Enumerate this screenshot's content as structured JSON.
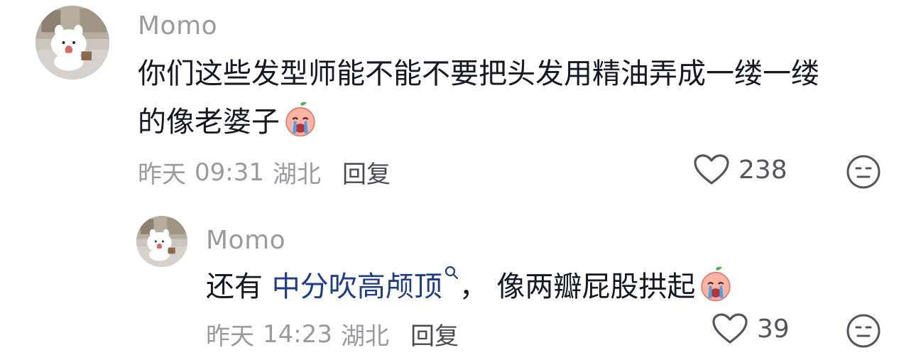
{
  "comments": [
    {
      "user": "Momo",
      "text_line1": "你们这些发型师能不能不要把头发用精油弄成一缕一缕",
      "text_line2": "的像老婆子",
      "emoji": "crying-face-icon",
      "date": "昨天",
      "time": "09:31",
      "location": "湖北",
      "reply_label": "回复",
      "likes": "238"
    }
  ],
  "reply": {
    "user": "Momo",
    "text_prefix": "还有 ",
    "link_text": "中分吹高颅顶",
    "text_suffix": "， 像两瓣屁股拱起",
    "emoji": "crying-face-icon",
    "date": "昨天",
    "time": "14:23",
    "location": "湖北",
    "reply_label": "回复",
    "likes": "39"
  },
  "colors": {
    "username": "#9a9aa0",
    "text": "#161823",
    "link": "#1f3c8a",
    "meta": "#9a9aa0"
  }
}
